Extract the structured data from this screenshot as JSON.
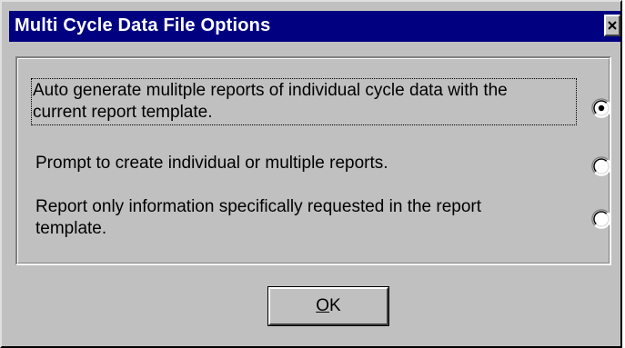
{
  "dialog": {
    "title": "Multi Cycle Data File Options",
    "close_icon": "close-icon"
  },
  "options": [
    {
      "line1": "Auto generate mulitple reports of individual cycle data with the",
      "line2": "current report template.",
      "selected": true
    },
    {
      "line1": "Prompt to create individual or multiple reports.",
      "line2": "",
      "selected": false
    },
    {
      "line1": "Report only information specifically requested in the report",
      "line2": "template.",
      "selected": false
    }
  ],
  "ok_button": {
    "mnemonic": "O",
    "rest": "K"
  },
  "colors": {
    "titlebar": "#000080",
    "face": "#c0c0c0"
  }
}
